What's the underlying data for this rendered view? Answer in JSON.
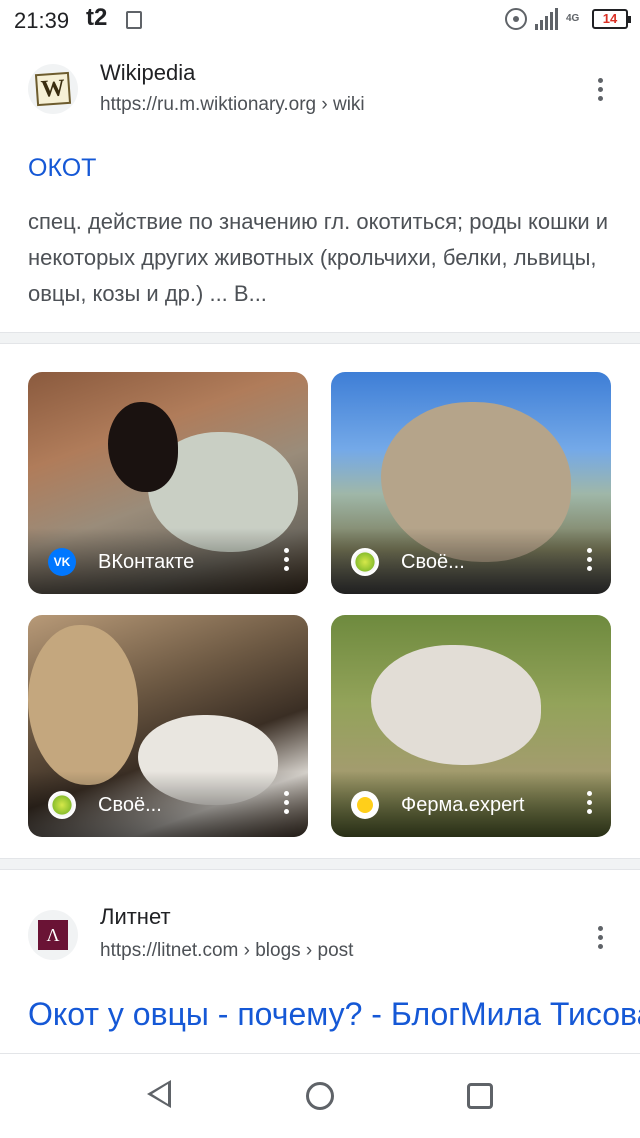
{
  "status_bar": {
    "time": "21:39",
    "carrier": "t2",
    "network": "4G",
    "battery": "14"
  },
  "result1": {
    "site_name": "Wikipedia",
    "url": "https://ru.m.wiktionary.org › wiki",
    "favicon_letter": "W",
    "title": "ОКОТ",
    "snippet": "спец. действие по значению гл. окотиться; роды кошки и некоторых других животных (крольчихи, белки, львицы, овцы, козы и др.) ... В..."
  },
  "images": [
    {
      "source": "ВКонтакте",
      "icon": "vk-icon",
      "icon_text": "VK"
    },
    {
      "source": "Своё...",
      "icon": "svoe-icon"
    },
    {
      "source": "Своё...",
      "icon": "svoe-icon"
    },
    {
      "source": "Ферма.expert",
      "icon": "ferma-icon"
    }
  ],
  "result2": {
    "site_name": "Литнет",
    "url": "https://litnet.com › blogs › post",
    "favicon_letter": "Λ",
    "title": "Окот у овцы - почему? - БлогМила Тисова"
  },
  "colors": {
    "link": "#1558d6",
    "snippet": "#4d5156",
    "divider": "#f1f3f4"
  }
}
